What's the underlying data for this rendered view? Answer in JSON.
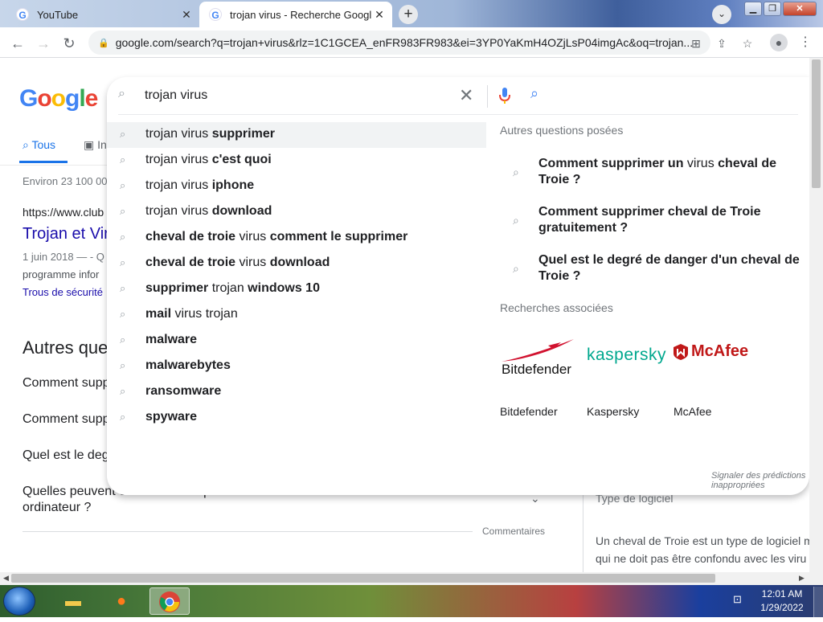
{
  "browser": {
    "tabs": [
      {
        "title": "YouTube",
        "active": false
      },
      {
        "title": "trojan virus - Recherche Google",
        "active": true
      }
    ],
    "new_tab": "+",
    "url": "google.com/search?q=trojan+virus&rlz=1C1GCEA_enFR983FR983&ei=3YP0YaKmH4OZjLsP04imgAc&oq=trojan..."
  },
  "google": {
    "logo": [
      "G",
      "o",
      "o",
      "g",
      "l",
      "e"
    ],
    "logo_colors": [
      "#4285f4",
      "#ea4335",
      "#fbbc05",
      "#4285f4",
      "#34a853",
      "#ea4335"
    ],
    "tabs": {
      "all": "Tous",
      "images": "In"
    },
    "about": "Environ 23 100 00",
    "result": {
      "cite": "https://www.club",
      "title": "Trojan et Vir",
      "date": "1 juin 2018 — - Q",
      "snippet": "programme infor",
      "link": "Trous de sécurité"
    },
    "paa": {
      "title": "Autres que",
      "items": [
        "Comment supp",
        "Comment supp",
        "Quel est le deg",
        "Quelles peuvent être les conséquences de l'installation d'un cheval de Troie sur votre ordinateur ?"
      ]
    },
    "comments": "Commentaires",
    "kp": {
      "type": "Type de logiciel",
      "text": [
        "Un cheval de Troie est un type de logiciel m",
        "qui ne doit pas être confondu avec les viru"
      ]
    }
  },
  "search": {
    "query": "trojan virus",
    "suggestions": [
      {
        "pre": "trojan virus ",
        "bold": "supprimer",
        "post": ""
      },
      {
        "pre": "trojan virus ",
        "bold": "c'est quoi",
        "post": ""
      },
      {
        "pre": "trojan virus ",
        "bold": "iphone",
        "post": ""
      },
      {
        "pre": "trojan virus ",
        "bold": "download",
        "post": ""
      },
      {
        "pre": "",
        "bold": "cheval de troie",
        "post": " virus ",
        "bold2": "comment le supprimer"
      },
      {
        "pre": "",
        "bold": "cheval de troie",
        "post": " virus ",
        "bold2": "download"
      },
      {
        "pre": "",
        "bold": "supprimer",
        "post": " trojan ",
        "bold2": "windows 10"
      },
      {
        "pre": "",
        "bold": "mail",
        "post": " virus trojan"
      },
      {
        "pre": "",
        "bold": "malware",
        "post": ""
      },
      {
        "pre": "",
        "bold": "malwarebytes",
        "post": ""
      },
      {
        "pre": "",
        "bold": "ransomware",
        "post": ""
      },
      {
        "pre": "",
        "bold": "spyware",
        "post": ""
      }
    ],
    "related_questions_title": "Autres questions posées",
    "related_questions": [
      {
        "a": "Comment supprimer un",
        "b": " virus ",
        "c": "cheval de Troie ?"
      },
      {
        "a": "Comment supprimer cheval de Troie gratuitement ?",
        "b": "",
        "c": ""
      },
      {
        "a": "Quel est le degré de danger d'un cheval de Troie ?",
        "b": "",
        "c": ""
      }
    ],
    "related_searches_title": "Recherches associées",
    "brands": [
      {
        "name": "Bitdefender",
        "color": "#d1122f"
      },
      {
        "name": "Kaspersky",
        "logo": "kaspersky",
        "color": "#00a88e"
      },
      {
        "name": "McAfee",
        "logo": "McAfee",
        "color": "#c01818"
      }
    ],
    "report": "Signaler des prédictions inappropriées"
  },
  "taskbar": {
    "time": "12:01 AM",
    "date": "1/29/2022"
  }
}
